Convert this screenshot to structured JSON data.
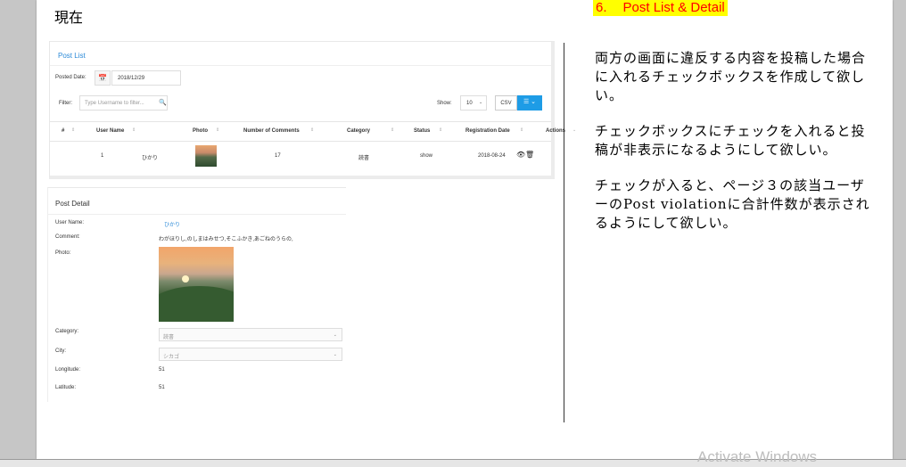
{
  "slide": {
    "heading_now": "現在",
    "section_number": "6.",
    "section_title": "Post List & Detail",
    "notes": [
      "両方の画面に違反する内容を投稿した場合に入れるチェックボックスを作成して欲しい。",
      "チェックボックスにチェックを入れると投稿が非表示になるようにして欲しい。",
      "チェックが入ると、ページ３の該当ユーザーのPost violationに合計件数が表示されるようにして欲しい。"
    ]
  },
  "post_list": {
    "title": "Post List",
    "posted_date_label": "Posted Date:",
    "posted_date_value": "2018/12/29",
    "filter_label": "Filter:",
    "filter_placeholder": "Type Username to filter...",
    "show_label": "Show:",
    "show_value": "10",
    "csv_label": "CSV",
    "columns": [
      "#",
      "User Name",
      "Photo",
      "Number of Comments",
      "Category",
      "Status",
      "Registration Date",
      "Actions"
    ],
    "rows": [
      {
        "num": "1",
        "user_name": "ひかり",
        "comments": "17",
        "category": "読書",
        "status": "show",
        "registration_date": "2018-08-24"
      }
    ]
  },
  "post_detail": {
    "title": "Post Detail",
    "user_name_label": "User Name:",
    "user_name_value": "ひかり",
    "comment_label": "Comment:",
    "comment_value": "わがほりし,のしまはみせつ,そこふかき,あごねのうらの,",
    "photo_label": "Photo:",
    "category_label": "Category:",
    "category_value": "読書",
    "city_label": "City:",
    "city_value": "シカゴ",
    "longitude_label": "Longitude:",
    "longitude_value": "51",
    "latitude_label": "Latitude:",
    "latitude_value": "51"
  },
  "os": {
    "watermark": "Activate Windows"
  },
  "icons": {
    "calendar": "calendar-icon",
    "search": "search-icon",
    "menu": "menu-icon",
    "eye": "eye-icon",
    "trash": "trash-icon"
  },
  "colors": {
    "accent": "#1e9ce6",
    "link": "#2b8ad8",
    "title_highlight": "#ffff00",
    "title_text": "#ff0000"
  }
}
